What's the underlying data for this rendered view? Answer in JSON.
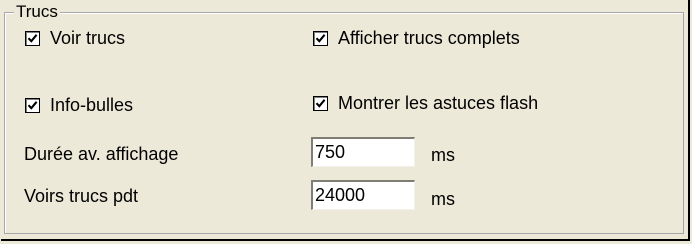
{
  "group": {
    "title": "Trucs"
  },
  "checkboxes": {
    "voir_trucs": {
      "label": "Voir trucs",
      "checked": true
    },
    "afficher_complets": {
      "label": "Afficher trucs complets",
      "checked": true
    },
    "info_bulles": {
      "label": "Info-bulles",
      "checked": true
    },
    "astuces_flash": {
      "label": "Montrer les astuces flash",
      "checked": true
    }
  },
  "fields": {
    "duree": {
      "label": "Durée av. affichage",
      "value": "750",
      "unit": "ms"
    },
    "voirs": {
      "label": "Voirs trucs pdt",
      "value": "24000",
      "unit": "ms"
    }
  },
  "icons": {
    "checkmark": "checkmark-icon"
  }
}
